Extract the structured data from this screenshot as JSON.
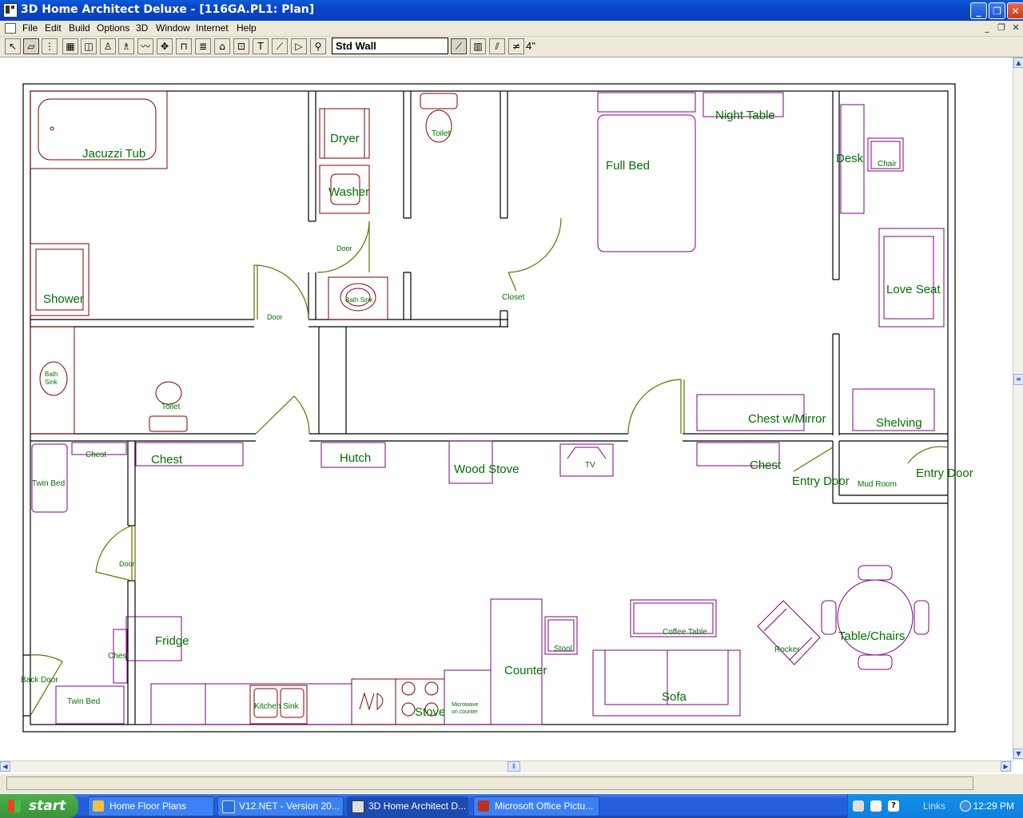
{
  "window": {
    "title": "3D Home Architect Deluxe - [116GA.PL1: Plan]"
  },
  "menu": [
    "File",
    "Edit",
    "Build",
    "Options",
    "3D",
    "Window",
    "Internet",
    "Help"
  ],
  "toolbar": {
    "wall_type": "Std Wall",
    "thickness": "4\""
  },
  "plan_labels": {
    "jacuzzi_tub": "Jacuzzi Tub",
    "dryer": "Dryer",
    "washer": "Washer",
    "toilet_1": "Toilet",
    "full_bed": "Full Bed",
    "night_table": "Night Table",
    "desk": "Desk",
    "chair": "Chair",
    "love_seat": "Love Seat",
    "shower": "Shower",
    "door_1": "Door",
    "door_2": "Door",
    "bath_sink_1": "Bath Sink",
    "closet": "Closet",
    "bath_sink_2": "Bath Sink",
    "toilet_2": "Toilet",
    "chest_w_mirror": "Chest w/Mirror",
    "shelving": "Shelving",
    "chest_1": "Chest",
    "chest_2": "Chest",
    "twin_bed_1": "Twin Bed",
    "hutch": "Hutch",
    "wood_stove": "Wood Stove",
    "tv": "TV",
    "chest_3": "Chest",
    "entry_door_1": "Entry Door",
    "mud_room": "Mud Room",
    "entry_door_2": "Entry Door",
    "door_3": "Door",
    "fridge": "Fridge",
    "chest_4": "Chest",
    "back_door": "Back Door",
    "twin_bed_2": "Twin Bed",
    "kitchen_sink": "Kitchen Sink",
    "stove": "Stove",
    "microwave": "Microwave on counter",
    "counter": "Counter",
    "stool": "Stool",
    "coffee_table": "Coffee Table",
    "sofa": "Sofa",
    "rocker": "Rocker",
    "table_chairs": "Table/Chairs"
  },
  "taskbar": {
    "start": "start",
    "tasks": [
      "Home Floor Plans",
      "V12.NET - Version 20...",
      "3D Home Architect D...",
      "Microsoft Office Pictu..."
    ],
    "links": "Links",
    "clock": "12:29 PM"
  }
}
